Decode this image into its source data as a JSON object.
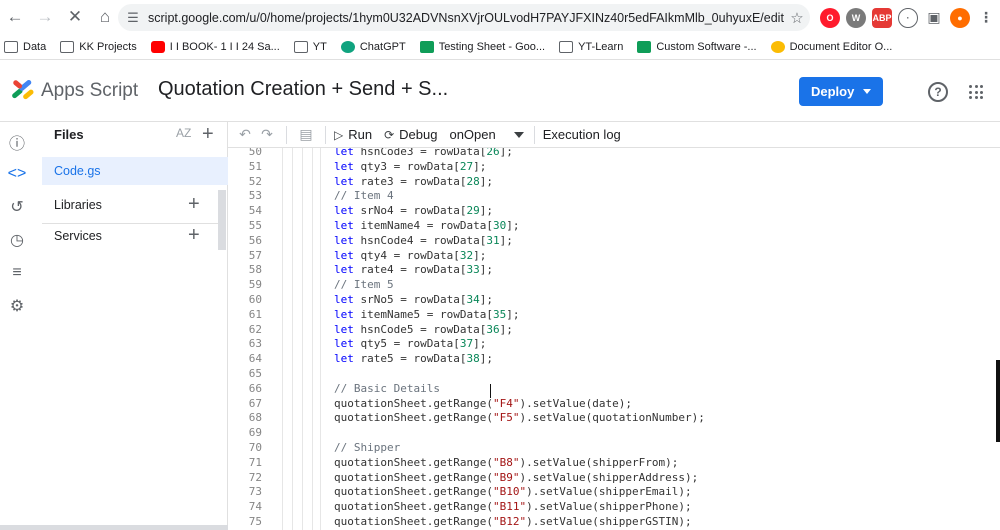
{
  "browser": {
    "url": "script.google.com/u/0/home/projects/1hym0U32ADVNsnXVjrOULvodH7PAYJFXINz40r5edFAIkmMlb_0uhyuxE/edit",
    "bookmarks": [
      {
        "label": "Data",
        "icon": "folder-icon"
      },
      {
        "label": "KK Projects",
        "icon": "folder-icon"
      },
      {
        "label": "I I BOOK- 1 I I 24 Sa...",
        "icon": "youtube-icon"
      },
      {
        "label": "YT",
        "icon": "folder-icon"
      },
      {
        "label": "ChatGPT",
        "icon": "chatgpt-icon"
      },
      {
        "label": "Testing Sheet - Goo...",
        "icon": "sheets-icon"
      },
      {
        "label": "YT-Learn",
        "icon": "folder-icon"
      },
      {
        "label": "Custom Software -...",
        "icon": "sheets-icon"
      },
      {
        "label": "Document Editor O...",
        "icon": "doc-icon"
      }
    ]
  },
  "header": {
    "app_name": "Apps Script",
    "project_title": "Quotation Creation + Send + S...",
    "deploy_label": "Deploy",
    "help_glyph": "?"
  },
  "files_panel": {
    "title": "Files",
    "sort_label": "AZ",
    "files": [
      {
        "name": "Code.gs"
      }
    ],
    "libraries_label": "Libraries",
    "services_label": "Services"
  },
  "toolbar": {
    "run_label": "Run",
    "debug_label": "Debug",
    "function_name": "onOpen",
    "execution_log_label": "Execution log"
  },
  "editor": {
    "lines": [
      {
        "n": "50",
        "t": [
          [
            "kw",
            "let"
          ],
          [
            "p",
            " hsnCode3 = rowData["
          ],
          [
            "num",
            "26"
          ],
          [
            "p",
            "];"
          ]
        ]
      },
      {
        "n": "51",
        "t": [
          [
            "kw",
            "let"
          ],
          [
            "p",
            " qty3 = rowData["
          ],
          [
            "num",
            "27"
          ],
          [
            "p",
            "];"
          ]
        ]
      },
      {
        "n": "52",
        "t": [
          [
            "kw",
            "let"
          ],
          [
            "p",
            " rate3 = rowData["
          ],
          [
            "num",
            "28"
          ],
          [
            "p",
            "];"
          ]
        ]
      },
      {
        "n": "53",
        "t": [
          [
            "cm",
            "// Item 4"
          ]
        ]
      },
      {
        "n": "54",
        "t": [
          [
            "kw",
            "let"
          ],
          [
            "p",
            " srNo4 = rowData["
          ],
          [
            "num",
            "29"
          ],
          [
            "p",
            "];"
          ]
        ]
      },
      {
        "n": "55",
        "t": [
          [
            "kw",
            "let"
          ],
          [
            "p",
            " itemName4 = rowData["
          ],
          [
            "num",
            "30"
          ],
          [
            "p",
            "];"
          ]
        ]
      },
      {
        "n": "56",
        "t": [
          [
            "kw",
            "let"
          ],
          [
            "p",
            " hsnCode4 = rowData["
          ],
          [
            "num",
            "31"
          ],
          [
            "p",
            "];"
          ]
        ]
      },
      {
        "n": "57",
        "t": [
          [
            "kw",
            "let"
          ],
          [
            "p",
            " qty4 = rowData["
          ],
          [
            "num",
            "32"
          ],
          [
            "p",
            "];"
          ]
        ]
      },
      {
        "n": "58",
        "t": [
          [
            "kw",
            "let"
          ],
          [
            "p",
            " rate4 = rowData["
          ],
          [
            "num",
            "33"
          ],
          [
            "p",
            "];"
          ]
        ]
      },
      {
        "n": "59",
        "t": [
          [
            "cm",
            "// Item 5"
          ]
        ]
      },
      {
        "n": "60",
        "t": [
          [
            "kw",
            "let"
          ],
          [
            "p",
            " srNo5 = rowData["
          ],
          [
            "num",
            "34"
          ],
          [
            "p",
            "];"
          ]
        ]
      },
      {
        "n": "61",
        "t": [
          [
            "kw",
            "let"
          ],
          [
            "p",
            " itemName5 = rowData["
          ],
          [
            "num",
            "35"
          ],
          [
            "p",
            "];"
          ]
        ]
      },
      {
        "n": "62",
        "t": [
          [
            "kw",
            "let"
          ],
          [
            "p",
            " hsnCode5 = rowData["
          ],
          [
            "num",
            "36"
          ],
          [
            "p",
            "];"
          ]
        ]
      },
      {
        "n": "63",
        "t": [
          [
            "kw",
            "let"
          ],
          [
            "p",
            " qty5 = rowData["
          ],
          [
            "num",
            "37"
          ],
          [
            "p",
            "];"
          ]
        ]
      },
      {
        "n": "64",
        "t": [
          [
            "kw",
            "let"
          ],
          [
            "p",
            " rate5 = rowData["
          ],
          [
            "num",
            "38"
          ],
          [
            "p",
            "];"
          ]
        ]
      },
      {
        "n": "65",
        "t": []
      },
      {
        "n": "66",
        "t": [
          [
            "cm",
            "// Basic Details"
          ]
        ]
      },
      {
        "n": "67",
        "t": [
          [
            "p",
            "quotationSheet.getRange("
          ],
          [
            "str",
            "\"F4\""
          ],
          [
            "p",
            ").setValue(date);"
          ]
        ]
      },
      {
        "n": "68",
        "t": [
          [
            "p",
            "quotationSheet.getRange("
          ],
          [
            "str",
            "\"F5\""
          ],
          [
            "p",
            ").setValue(quotationNumber);"
          ]
        ]
      },
      {
        "n": "69",
        "t": []
      },
      {
        "n": "70",
        "t": [
          [
            "cm",
            "// Shipper"
          ]
        ]
      },
      {
        "n": "71",
        "t": [
          [
            "p",
            "quotationSheet.getRange("
          ],
          [
            "str",
            "\"B8\""
          ],
          [
            "p",
            ").setValue(shipperFrom);"
          ]
        ]
      },
      {
        "n": "72",
        "t": [
          [
            "p",
            "quotationSheet.getRange("
          ],
          [
            "str",
            "\"B9\""
          ],
          [
            "p",
            ").setValue(shipperAddress);"
          ]
        ]
      },
      {
        "n": "73",
        "t": [
          [
            "p",
            "quotationSheet.getRange("
          ],
          [
            "str",
            "\"B10\""
          ],
          [
            "p",
            ").setValue(shipperEmail);"
          ]
        ]
      },
      {
        "n": "74",
        "t": [
          [
            "p",
            "quotationSheet.getRange("
          ],
          [
            "str",
            "\"B11\""
          ],
          [
            "p",
            ").setValue(shipperPhone);"
          ]
        ]
      },
      {
        "n": "75",
        "t": [
          [
            "p",
            "quotationSheet.getRange("
          ],
          [
            "str",
            "\"B12\""
          ],
          [
            "p",
            ").setValue(shipperGSTIN);"
          ]
        ]
      }
    ]
  },
  "colors": {
    "accent": "#1a73e8",
    "keyword": "#0000ff",
    "number": "#098658",
    "string": "#a31515",
    "comment": "#6a737d"
  }
}
